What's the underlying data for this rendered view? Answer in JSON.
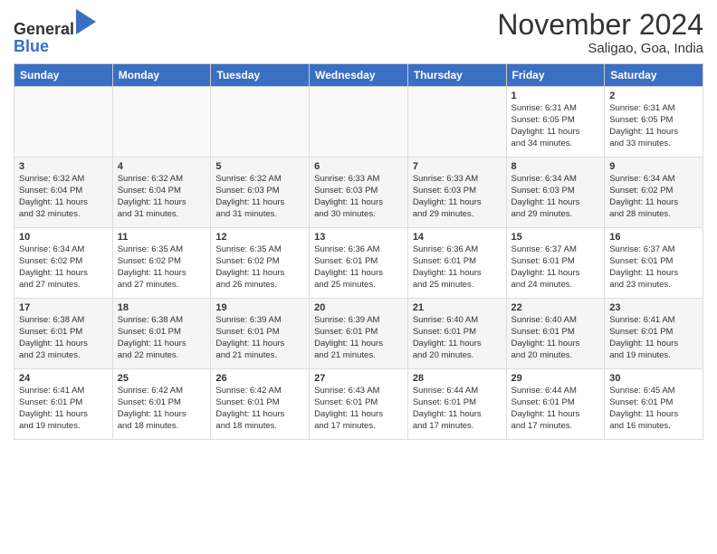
{
  "header": {
    "logo_general": "General",
    "logo_blue": "Blue",
    "month_title": "November 2024",
    "location": "Saligao, Goa, India"
  },
  "weekdays": [
    "Sunday",
    "Monday",
    "Tuesday",
    "Wednesday",
    "Thursday",
    "Friday",
    "Saturday"
  ],
  "weeks": [
    [
      {
        "day": "",
        "info": ""
      },
      {
        "day": "",
        "info": ""
      },
      {
        "day": "",
        "info": ""
      },
      {
        "day": "",
        "info": ""
      },
      {
        "day": "",
        "info": ""
      },
      {
        "day": "1",
        "info": "Sunrise: 6:31 AM\nSunset: 6:05 PM\nDaylight: 11 hours\nand 34 minutes."
      },
      {
        "day": "2",
        "info": "Sunrise: 6:31 AM\nSunset: 6:05 PM\nDaylight: 11 hours\nand 33 minutes."
      }
    ],
    [
      {
        "day": "3",
        "info": "Sunrise: 6:32 AM\nSunset: 6:04 PM\nDaylight: 11 hours\nand 32 minutes."
      },
      {
        "day": "4",
        "info": "Sunrise: 6:32 AM\nSunset: 6:04 PM\nDaylight: 11 hours\nand 31 minutes."
      },
      {
        "day": "5",
        "info": "Sunrise: 6:32 AM\nSunset: 6:03 PM\nDaylight: 11 hours\nand 31 minutes."
      },
      {
        "day": "6",
        "info": "Sunrise: 6:33 AM\nSunset: 6:03 PM\nDaylight: 11 hours\nand 30 minutes."
      },
      {
        "day": "7",
        "info": "Sunrise: 6:33 AM\nSunset: 6:03 PM\nDaylight: 11 hours\nand 29 minutes."
      },
      {
        "day": "8",
        "info": "Sunrise: 6:34 AM\nSunset: 6:03 PM\nDaylight: 11 hours\nand 29 minutes."
      },
      {
        "day": "9",
        "info": "Sunrise: 6:34 AM\nSunset: 6:02 PM\nDaylight: 11 hours\nand 28 minutes."
      }
    ],
    [
      {
        "day": "10",
        "info": "Sunrise: 6:34 AM\nSunset: 6:02 PM\nDaylight: 11 hours\nand 27 minutes."
      },
      {
        "day": "11",
        "info": "Sunrise: 6:35 AM\nSunset: 6:02 PM\nDaylight: 11 hours\nand 27 minutes."
      },
      {
        "day": "12",
        "info": "Sunrise: 6:35 AM\nSunset: 6:02 PM\nDaylight: 11 hours\nand 26 minutes."
      },
      {
        "day": "13",
        "info": "Sunrise: 6:36 AM\nSunset: 6:01 PM\nDaylight: 11 hours\nand 25 minutes."
      },
      {
        "day": "14",
        "info": "Sunrise: 6:36 AM\nSunset: 6:01 PM\nDaylight: 11 hours\nand 25 minutes."
      },
      {
        "day": "15",
        "info": "Sunrise: 6:37 AM\nSunset: 6:01 PM\nDaylight: 11 hours\nand 24 minutes."
      },
      {
        "day": "16",
        "info": "Sunrise: 6:37 AM\nSunset: 6:01 PM\nDaylight: 11 hours\nand 23 minutes."
      }
    ],
    [
      {
        "day": "17",
        "info": "Sunrise: 6:38 AM\nSunset: 6:01 PM\nDaylight: 11 hours\nand 23 minutes."
      },
      {
        "day": "18",
        "info": "Sunrise: 6:38 AM\nSunset: 6:01 PM\nDaylight: 11 hours\nand 22 minutes."
      },
      {
        "day": "19",
        "info": "Sunrise: 6:39 AM\nSunset: 6:01 PM\nDaylight: 11 hours\nand 21 minutes."
      },
      {
        "day": "20",
        "info": "Sunrise: 6:39 AM\nSunset: 6:01 PM\nDaylight: 11 hours\nand 21 minutes."
      },
      {
        "day": "21",
        "info": "Sunrise: 6:40 AM\nSunset: 6:01 PM\nDaylight: 11 hours\nand 20 minutes."
      },
      {
        "day": "22",
        "info": "Sunrise: 6:40 AM\nSunset: 6:01 PM\nDaylight: 11 hours\nand 20 minutes."
      },
      {
        "day": "23",
        "info": "Sunrise: 6:41 AM\nSunset: 6:01 PM\nDaylight: 11 hours\nand 19 minutes."
      }
    ],
    [
      {
        "day": "24",
        "info": "Sunrise: 6:41 AM\nSunset: 6:01 PM\nDaylight: 11 hours\nand 19 minutes."
      },
      {
        "day": "25",
        "info": "Sunrise: 6:42 AM\nSunset: 6:01 PM\nDaylight: 11 hours\nand 18 minutes."
      },
      {
        "day": "26",
        "info": "Sunrise: 6:42 AM\nSunset: 6:01 PM\nDaylight: 11 hours\nand 18 minutes."
      },
      {
        "day": "27",
        "info": "Sunrise: 6:43 AM\nSunset: 6:01 PM\nDaylight: 11 hours\nand 17 minutes."
      },
      {
        "day": "28",
        "info": "Sunrise: 6:44 AM\nSunset: 6:01 PM\nDaylight: 11 hours\nand 17 minutes."
      },
      {
        "day": "29",
        "info": "Sunrise: 6:44 AM\nSunset: 6:01 PM\nDaylight: 11 hours\nand 17 minutes."
      },
      {
        "day": "30",
        "info": "Sunrise: 6:45 AM\nSunset: 6:01 PM\nDaylight: 11 hours\nand 16 minutes."
      }
    ]
  ]
}
